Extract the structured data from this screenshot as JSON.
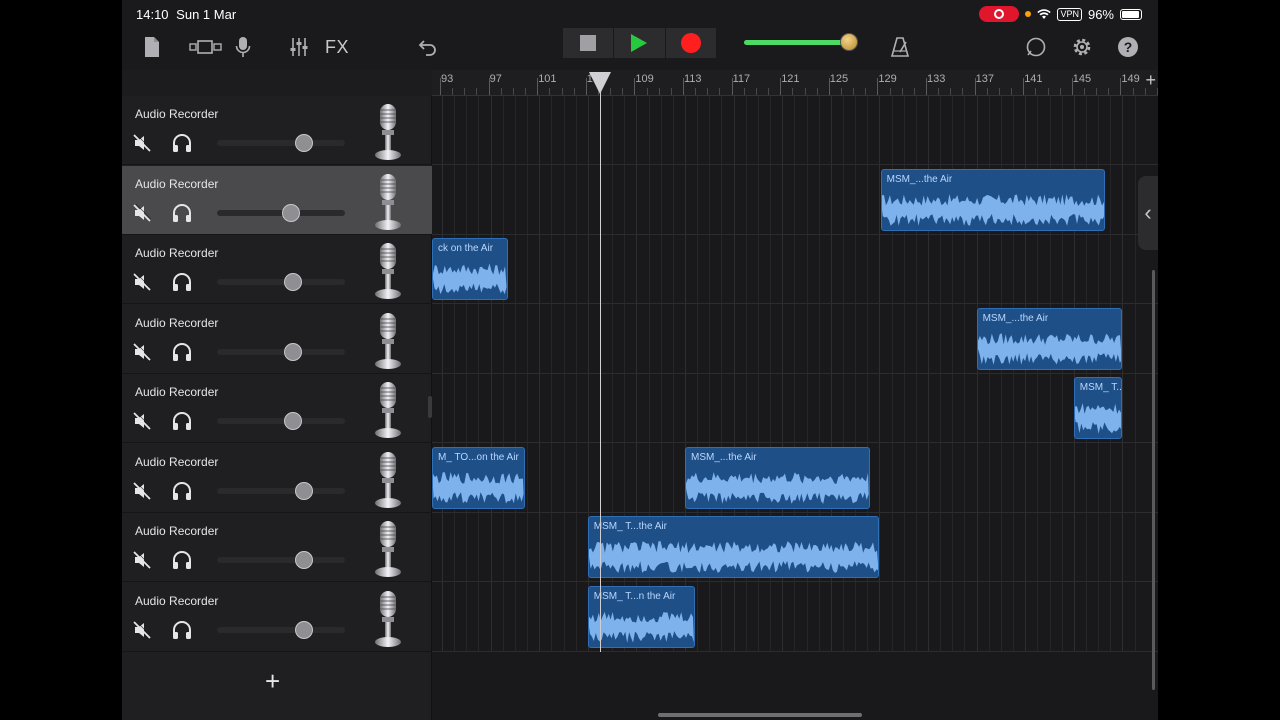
{
  "status_bar": {
    "time": "14:10",
    "date": "Sun 1 Mar",
    "vpn": "VPN",
    "battery": "96%"
  },
  "toolbar": {
    "fx_label": "FX",
    "items": [
      "document-icon",
      "tracks-view-icon",
      "mic-icon",
      "mixer-icon",
      "undo-icon",
      "stop-button",
      "play-button",
      "record-button",
      "master-volume",
      "metronome-icon",
      "loop-icon",
      "settings-icon",
      "help-icon"
    ],
    "master_volume_level": 0.95
  },
  "ruler": {
    "bars": [
      "93",
      "97",
      "101",
      "105",
      "109",
      "113",
      "117",
      "121",
      "125",
      "129",
      "133",
      "137",
      "141",
      "145",
      "149"
    ],
    "add_label": "+"
  },
  "tracks": [
    {
      "name": "Audio Recorder",
      "volume": 0.68,
      "selected": false
    },
    {
      "name": "Audio Recorder",
      "volume": 0.58,
      "selected": true
    },
    {
      "name": "Audio Recorder",
      "volume": 0.59,
      "selected": false
    },
    {
      "name": "Audio Recorder",
      "volume": 0.59,
      "selected": false
    },
    {
      "name": "Audio Recorder",
      "volume": 0.59,
      "selected": false
    },
    {
      "name": "Audio Recorder",
      "volume": 0.68,
      "selected": false
    },
    {
      "name": "Audio Recorder",
      "volume": 0.68,
      "selected": false
    },
    {
      "name": "Audio Recorder",
      "volume": 0.68,
      "selected": false
    }
  ],
  "add_track_label": "+",
  "regions": [
    {
      "lane": 1,
      "label": "MSM_...the Air",
      "start_bar": 129.1,
      "end_bar": 147.6
    },
    {
      "lane": 2,
      "label": "ck on the Air",
      "start_bar": 92.0,
      "end_bar": 98.4
    },
    {
      "lane": 3,
      "label": "MSM_...the Air",
      "start_bar": 137.0,
      "end_bar": 149.0
    },
    {
      "lane": 4,
      "label": "MSM_ T...the",
      "start_bar": 145.0,
      "end_bar": 149.0
    },
    {
      "lane": 5,
      "label": "M_ TO...on the Air",
      "start_bar": 92.0,
      "end_bar": 99.8
    },
    {
      "lane": 5,
      "label": "MSM_...the Air",
      "start_bar": 113.0,
      "end_bar": 128.2
    },
    {
      "lane": 6,
      "label": "MSM_ T...the Air",
      "start_bar": 105.0,
      "end_bar": 129.0
    },
    {
      "lane": 7,
      "label": "MSM_ T...n the Air",
      "start_bar": 105.0,
      "end_bar": 113.8
    }
  ],
  "playhead_bar": 105.5
}
